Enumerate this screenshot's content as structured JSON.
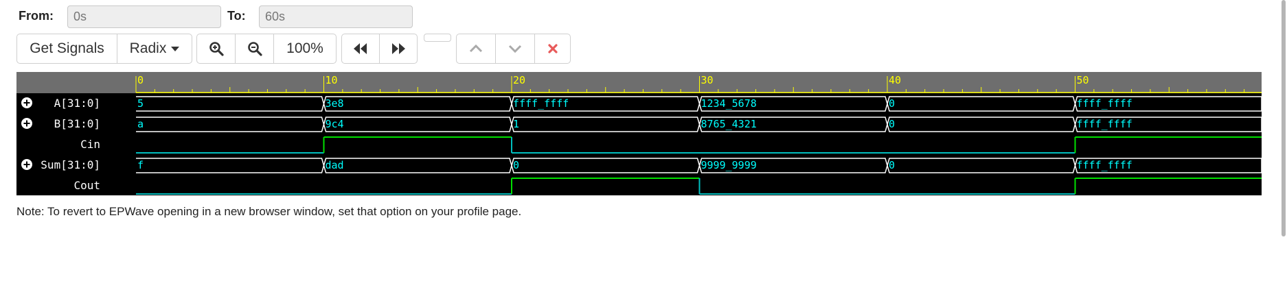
{
  "range": {
    "from_label": "From:",
    "from_value": "0s",
    "to_label": "To:",
    "to_value": "60s"
  },
  "toolbar": {
    "get_signals_label": "Get Signals",
    "radix_label": "Radix",
    "zoom_level": "100%",
    "icons": [
      "zoom-in-icon",
      "zoom-out-icon",
      "fast-rewind-icon",
      "fast-forward-icon",
      "chevron-up-icon",
      "chevron-down-icon",
      "close-icon"
    ]
  },
  "waveform": {
    "time_ticks": [
      "0",
      "10",
      "20",
      "30",
      "40",
      "50"
    ],
    "time_range": [
      0,
      60
    ],
    "colors": {
      "background": "#000000",
      "ruler": "#6e6e6e",
      "ruler_text": "#ffff00",
      "value_text": "#00ffff",
      "bus_outline": "#ffffff",
      "bit_low": "#00bfbf",
      "bit_high": "#00e000",
      "signal_name": "#ffffff",
      "close_icon": "#e85a5a"
    },
    "signals": [
      {
        "name": "A[31:0]",
        "type": "bus",
        "expandable": true,
        "segments": [
          {
            "start": 0,
            "end": 10,
            "value": "5"
          },
          {
            "start": 10,
            "end": 20,
            "value": "3e8"
          },
          {
            "start": 20,
            "end": 30,
            "value": "ffff_ffff"
          },
          {
            "start": 30,
            "end": 40,
            "value": "1234_5678"
          },
          {
            "start": 40,
            "end": 50,
            "value": "0"
          },
          {
            "start": 50,
            "end": 60,
            "value": "ffff_ffff"
          }
        ]
      },
      {
        "name": "B[31:0]",
        "type": "bus",
        "expandable": true,
        "segments": [
          {
            "start": 0,
            "end": 10,
            "value": "a"
          },
          {
            "start": 10,
            "end": 20,
            "value": "9c4"
          },
          {
            "start": 20,
            "end": 30,
            "value": "1"
          },
          {
            "start": 30,
            "end": 40,
            "value": "8765_4321"
          },
          {
            "start": 40,
            "end": 50,
            "value": "0"
          },
          {
            "start": 50,
            "end": 60,
            "value": "ffff_ffff"
          }
        ]
      },
      {
        "name": "Cin",
        "type": "bit",
        "expandable": false,
        "segments": [
          {
            "start": 0,
            "end": 10,
            "value": 0
          },
          {
            "start": 10,
            "end": 20,
            "value": 1
          },
          {
            "start": 20,
            "end": 50,
            "value": 0
          },
          {
            "start": 50,
            "end": 60,
            "value": 1
          }
        ]
      },
      {
        "name": "Sum[31:0]",
        "type": "bus",
        "expandable": true,
        "segments": [
          {
            "start": 0,
            "end": 10,
            "value": "f"
          },
          {
            "start": 10,
            "end": 20,
            "value": "dad"
          },
          {
            "start": 20,
            "end": 30,
            "value": "0"
          },
          {
            "start": 30,
            "end": 40,
            "value": "9999_9999"
          },
          {
            "start": 40,
            "end": 50,
            "value": "0"
          },
          {
            "start": 50,
            "end": 60,
            "value": "ffff_ffff"
          }
        ]
      },
      {
        "name": "Cout",
        "type": "bit",
        "expandable": false,
        "segments": [
          {
            "start": 0,
            "end": 20,
            "value": 0
          },
          {
            "start": 20,
            "end": 30,
            "value": 1
          },
          {
            "start": 30,
            "end": 50,
            "value": 0
          },
          {
            "start": 50,
            "end": 60,
            "value": 1
          }
        ]
      }
    ]
  },
  "note": "Note: To revert to EPWave opening in a new browser window, set that option on your profile page."
}
